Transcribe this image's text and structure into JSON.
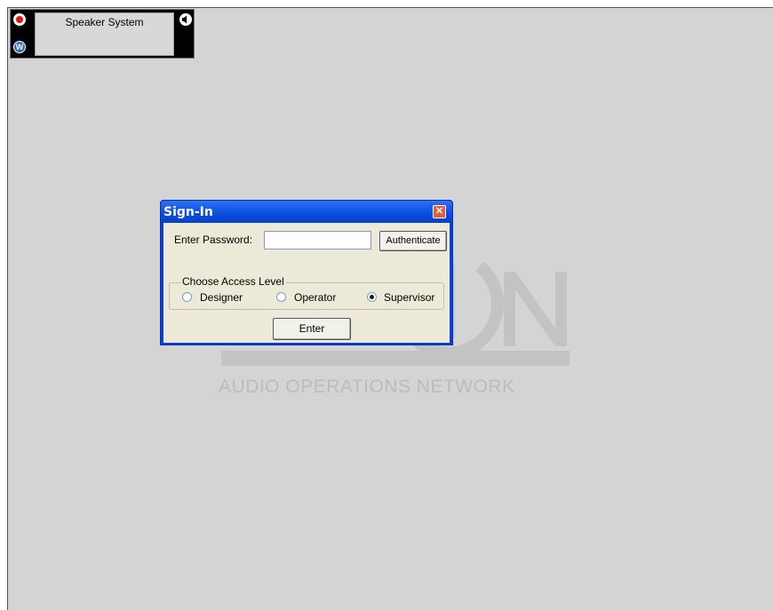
{
  "speaker": {
    "label": "Speaker System",
    "w_label": "W",
    "record_icon": "record-icon",
    "mute_icon": "speaker-mute-icon"
  },
  "watermark": {
    "text": "AUDIO OPERATIONS NETWORK",
    "logo_fragment": "ON"
  },
  "dialog": {
    "title": "Sign-In",
    "close_icon": "close-icon",
    "password_label": "Enter Password:",
    "password_value": "",
    "authenticate_label": "Authenticate",
    "access_group_label": "Choose Access Level",
    "access_levels": [
      {
        "label": "Designer",
        "selected": false
      },
      {
        "label": "Operator",
        "selected": false
      },
      {
        "label": "Supervisor",
        "selected": true
      }
    ],
    "enter_label": "Enter"
  },
  "colors": {
    "titlebar": "#0a4be0",
    "client": "#ece9d8",
    "canvas": "#d4d4d4",
    "close": "#e35c3c",
    "record": "#e0161a",
    "w_button": "#2c6bbf"
  }
}
